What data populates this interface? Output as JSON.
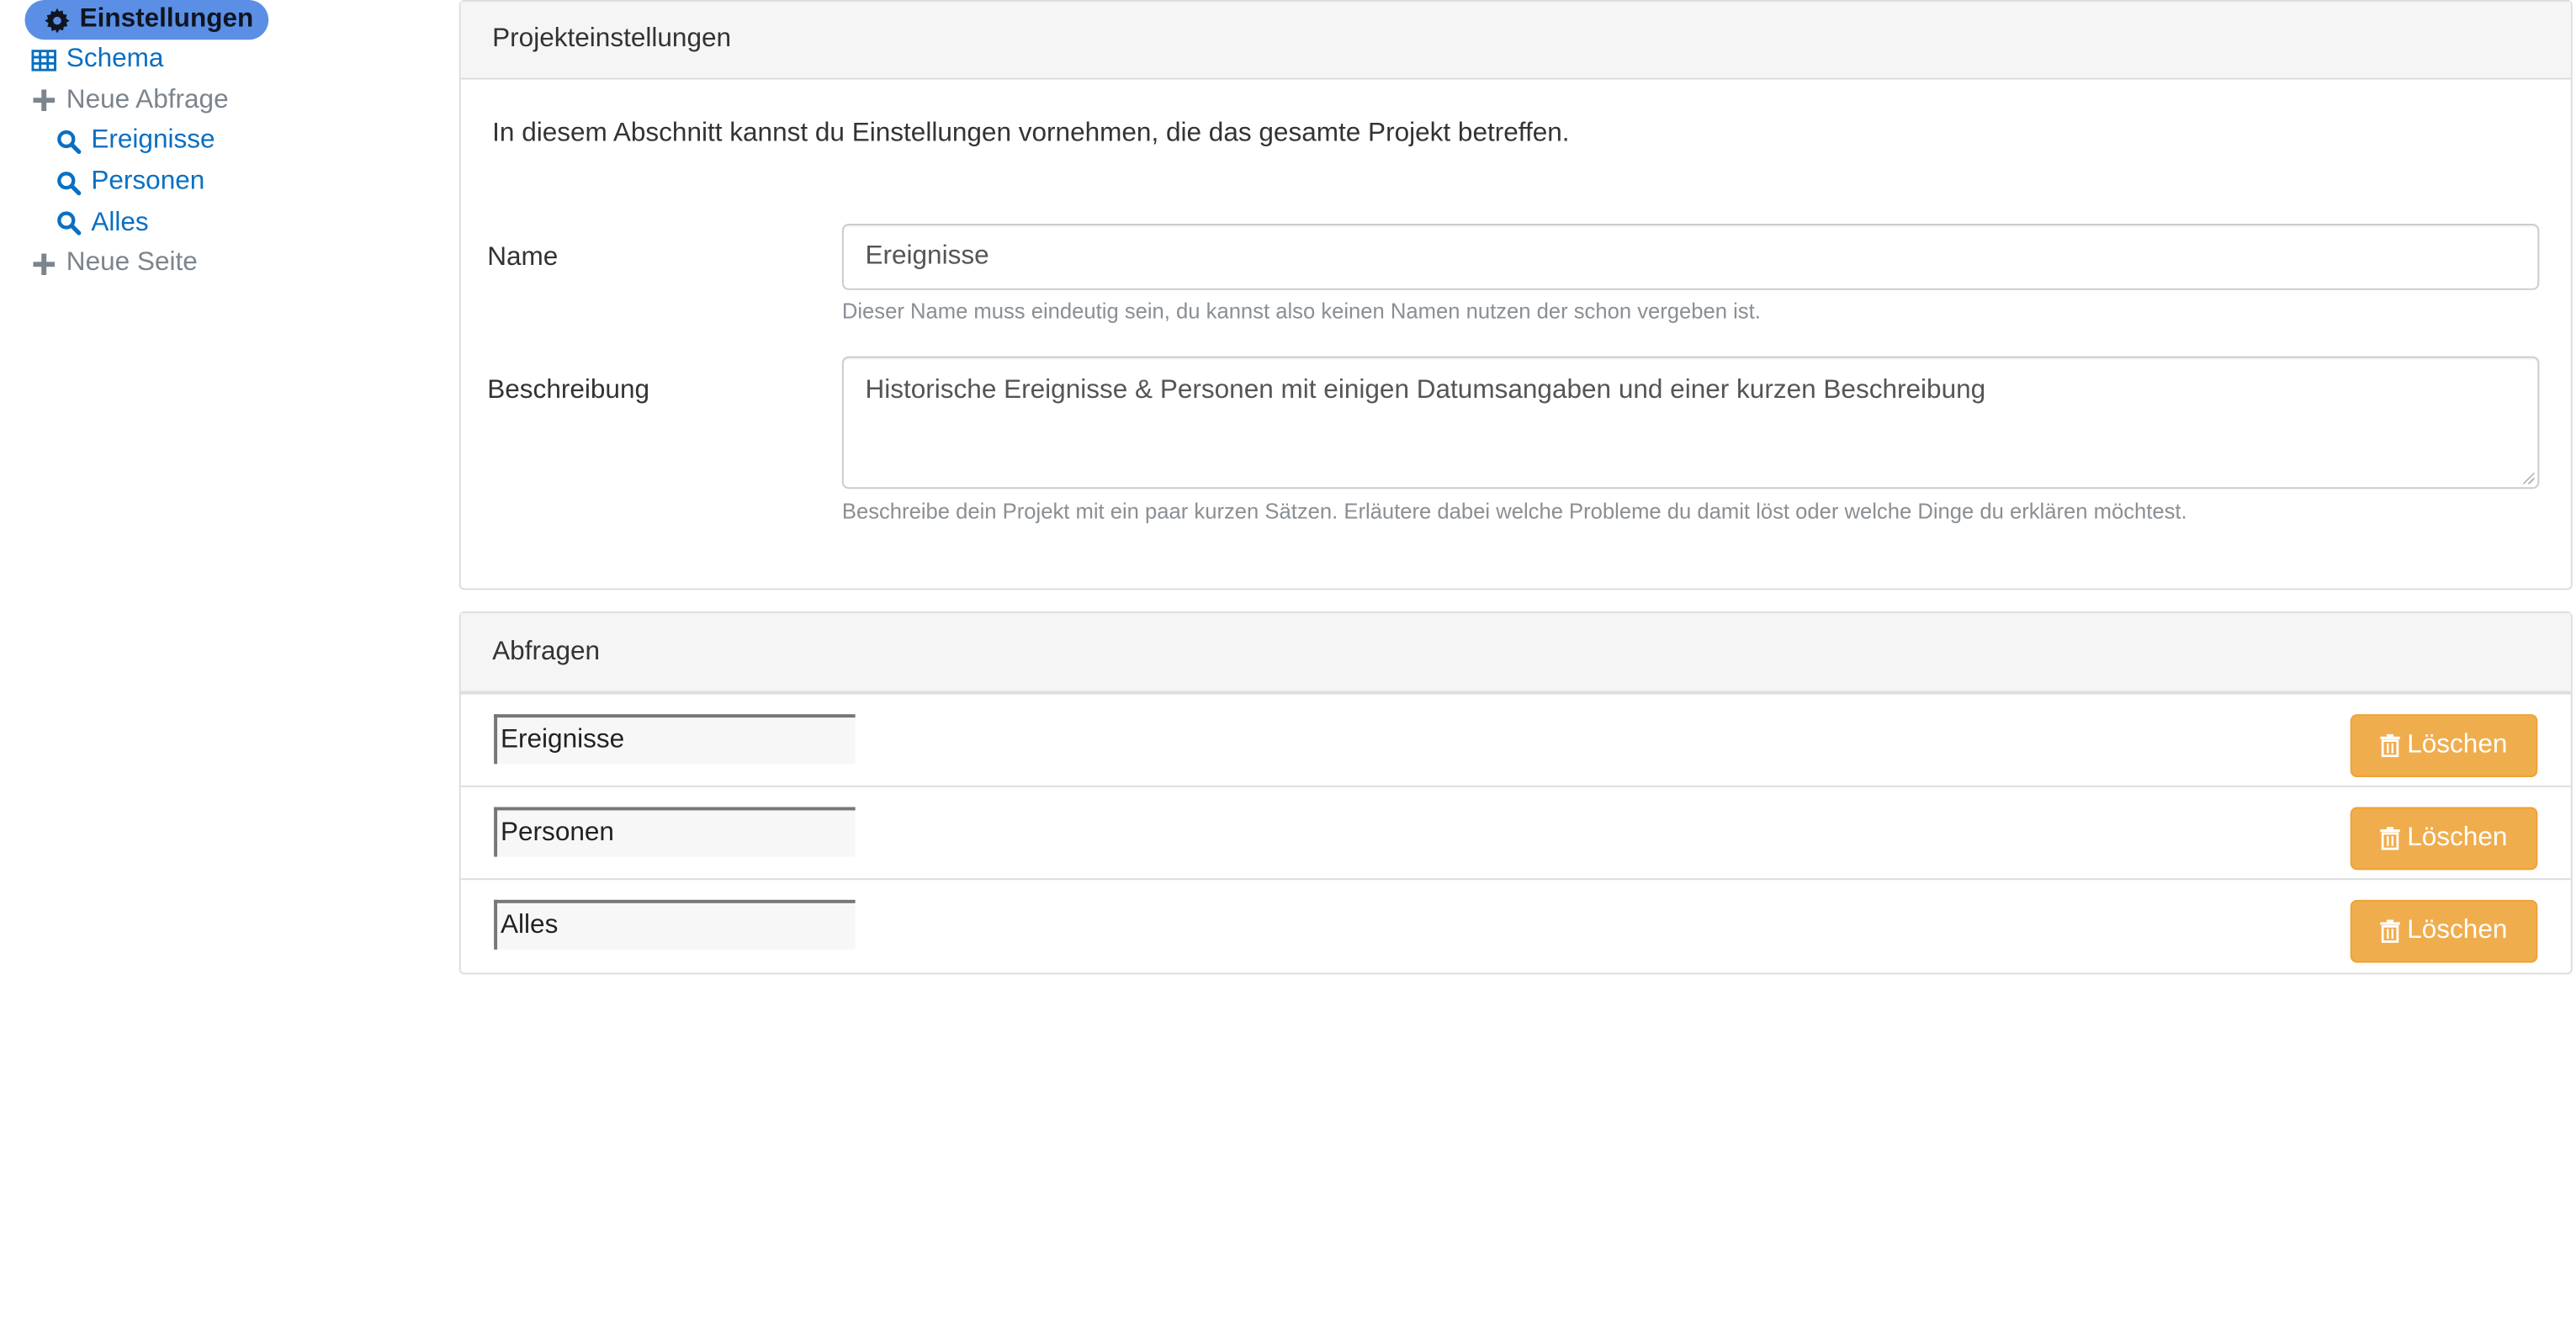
{
  "sidebar": {
    "items": [
      {
        "label": "Einstellungen",
        "icon": "gear-icon"
      },
      {
        "label": "Schema",
        "icon": "table-icon"
      },
      {
        "label": "Neue Abfrage",
        "icon": "plus-icon"
      },
      {
        "label": "Ereignisse",
        "icon": "search-icon"
      },
      {
        "label": "Personen",
        "icon": "search-icon"
      },
      {
        "label": "Alles",
        "icon": "search-icon"
      },
      {
        "label": "Neue Seite",
        "icon": "plus-icon"
      }
    ]
  },
  "settings": {
    "heading": "Projekteinstellungen",
    "intro": "In diesem Abschnitt kannst du Einstellungen vornehmen, die das gesamte Projekt betreffen.",
    "name": {
      "label": "Name",
      "value": "Ereignisse",
      "help": "Dieser Name muss eindeutig sein, du kannst also keinen Namen nutzen der schon vergeben ist."
    },
    "description": {
      "label": "Beschreibung",
      "value": "Historische Ereignisse & Personen mit einigen Datumsangaben und einer kurzen Beschreibung",
      "help": "Beschreibe dein Projekt mit ein paar kurzen Sätzen. Erläutere dabei welche Probleme du damit löst oder welche Dinge du erklären möchtest."
    }
  },
  "queries": {
    "heading": "Abfragen",
    "delete_label": "Löschen",
    "rows": [
      {
        "name": "Ereignisse"
      },
      {
        "name": "Personen"
      },
      {
        "name": "Alles"
      }
    ]
  },
  "colors": {
    "active_pill": "#5b8fe5",
    "link": "#0a6fc2",
    "muted": "#7c858d",
    "warning_button": "#f0ad4e"
  }
}
